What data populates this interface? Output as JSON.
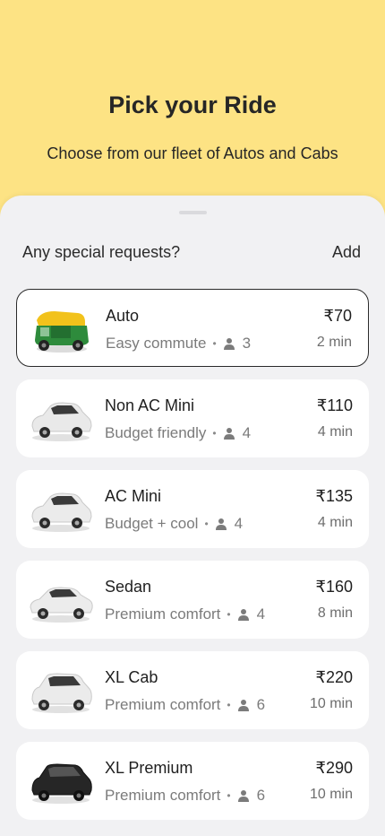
{
  "header": {
    "title": "Pick your Ride",
    "subtitle": "Choose from our fleet of Autos and Cabs"
  },
  "requests": {
    "label": "Any special requests?",
    "action": "Add"
  },
  "rides": [
    {
      "name": "Auto",
      "tagline": "Easy commute",
      "seats": "3",
      "price": "₹70",
      "eta": "2 min",
      "vehicle": "auto-rickshaw-icon",
      "color": "#2f8a3a",
      "selected": true
    },
    {
      "name": "Non AC Mini",
      "tagline": "Budget friendly",
      "seats": "4",
      "price": "₹110",
      "eta": "4 min",
      "vehicle": "hatchback-icon",
      "color": "#e8e8e8",
      "selected": false
    },
    {
      "name": "AC Mini",
      "tagline": "Budget + cool",
      "seats": "4",
      "price": "₹135",
      "eta": "4 min",
      "vehicle": "hatchback-icon",
      "color": "#e8e8e8",
      "selected": false
    },
    {
      "name": "Sedan",
      "tagline": "Premium comfort",
      "seats": "4",
      "price": "₹160",
      "eta": "8 min",
      "vehicle": "sedan-icon",
      "color": "#e8e8e8",
      "selected": false
    },
    {
      "name": "XL Cab",
      "tagline": "Premium comfort",
      "seats": "6",
      "price": "₹220",
      "eta": "10 min",
      "vehicle": "suv-icon",
      "color": "#e8e8e8",
      "selected": false
    },
    {
      "name": "XL Premium",
      "tagline": "Premium comfort",
      "seats": "6",
      "price": "₹290",
      "eta": "10 min",
      "vehicle": "suv-icon",
      "color": "#222222",
      "selected": false
    }
  ]
}
